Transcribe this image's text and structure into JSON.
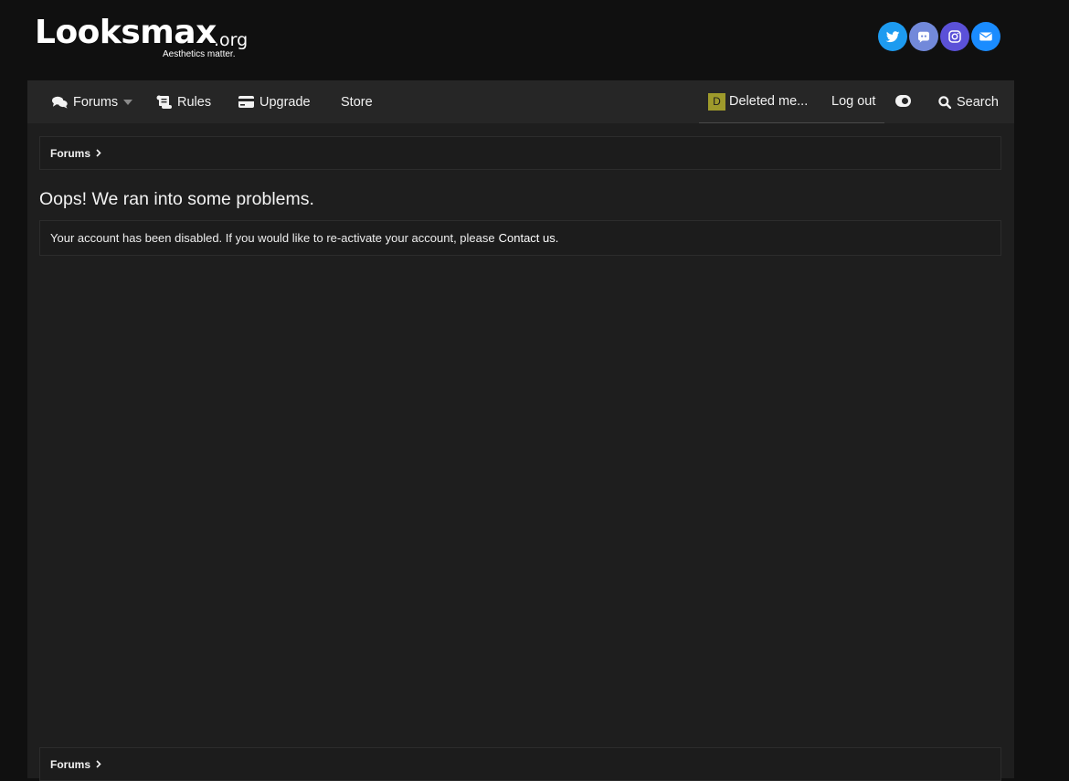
{
  "header": {
    "logo_text": "Looksmax",
    "logo_suffix": ".org",
    "logo_tagline": "Aesthetics matter.",
    "socials": [
      {
        "name": "twitter",
        "icon": "twitter-icon",
        "color": "#1d9bf0"
      },
      {
        "name": "discord",
        "icon": "discord-icon",
        "color": "#7289da"
      },
      {
        "name": "instagram",
        "icon": "instagram-icon",
        "color": "#5b51d8"
      },
      {
        "name": "email",
        "icon": "envelope-icon",
        "color": "#1a8cff"
      }
    ]
  },
  "nav": {
    "forums": {
      "label": "Forums",
      "icon": "comments-icon"
    },
    "rules": {
      "label": "Rules",
      "icon": "scroll-icon"
    },
    "upgrade": {
      "label": "Upgrade",
      "icon": "credit-card-icon"
    },
    "store": {
      "label": "Store"
    },
    "user": {
      "avatar_letter": "D",
      "avatar_color": "#9e9a2b",
      "name": "Deleted me..."
    },
    "logout": {
      "label": "Log out"
    },
    "theme_toggle": {
      "icon": "toggle-icon"
    },
    "search": {
      "label": "Search",
      "icon": "search-icon"
    }
  },
  "breadcrumb_top": {
    "label": "Forums"
  },
  "main": {
    "title": "Oops! We ran into some problems.",
    "message": "Your account has been disabled. If you would like to re-activate your account, please",
    "contact_link": "Contact us."
  },
  "breadcrumb_bottom": {
    "label": "Forums"
  },
  "colors": {
    "page_bg": "#101010",
    "container_bg": "#1e1e1e",
    "navbar_bg": "#262626",
    "text": "#f2f2f2"
  }
}
